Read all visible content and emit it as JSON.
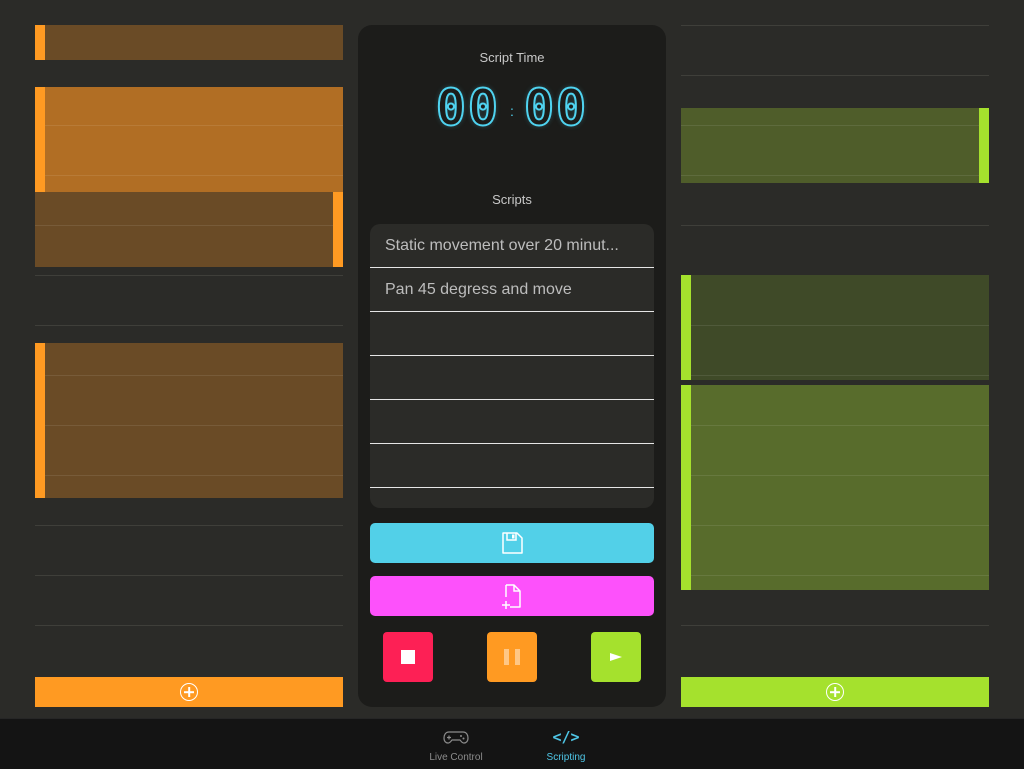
{
  "colors": {
    "background": "#2b2b28",
    "panel": "#1c1c1a",
    "orange": "#ff9a22",
    "lime": "#a5e12d",
    "cyan": "#52d0e8",
    "magenta": "#fd51fb",
    "red": "#fd2055",
    "tab_active": "#4fc6e6"
  },
  "timer_panel": {
    "label": "Script Time",
    "minutes": "00",
    "separator": ":",
    "seconds": "00"
  },
  "scripts_section": {
    "label": "Scripts",
    "items": [
      "Static movement over 20 minut...",
      "Pan 45 degress and move",
      "",
      "",
      "",
      ""
    ]
  },
  "buttons": {
    "save_icon": "save-icon",
    "new_script_icon": "new-file-icon",
    "stop_icon": "stop-icon",
    "pause_icon": "pause-icon",
    "play_icon": "play-icon",
    "add_icon": "plus-circle-icon"
  },
  "tabs": [
    {
      "label": "Live Control",
      "icon": "gamepad-icon",
      "active": false
    },
    {
      "label": "Scripting",
      "icon": "code-icon",
      "active": true
    }
  ]
}
